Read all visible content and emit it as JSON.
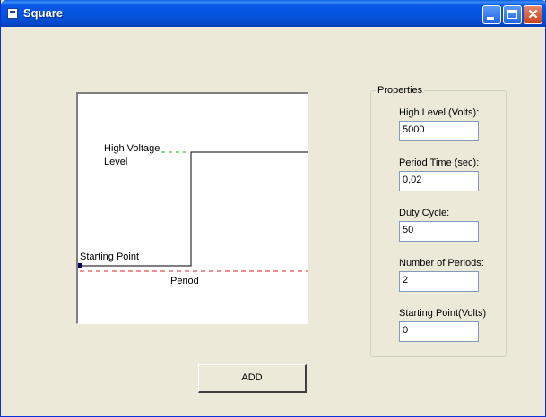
{
  "window": {
    "title": "Square"
  },
  "titlebar_buttons": {
    "minimize_icon": "minimize-icon",
    "maximize_icon": "maximize-icon",
    "close_glyph": "✕"
  },
  "diagram": {
    "high_voltage_label_line1": "High Voltage",
    "high_voltage_label_line2": "Level",
    "starting_point_label": "Starting Point",
    "period_label": "Period"
  },
  "properties": {
    "group_title": "Properties",
    "fields": [
      {
        "label": "High Level (Volts):",
        "value": "5000"
      },
      {
        "label": "Period Time (sec):",
        "value": "0,02"
      },
      {
        "label": "Duty Cycle:",
        "value": "50"
      },
      {
        "label": "Number of Periods:",
        "value": "2"
      },
      {
        "label": "Starting Point(Volts)",
        "value": "0"
      }
    ]
  },
  "actions": {
    "add_label": "ADD"
  },
  "colors": {
    "titlebar": "#0553dd",
    "window_bg": "#ece9d8",
    "dash_red": "#e02020",
    "dash_green": "#20a020"
  }
}
